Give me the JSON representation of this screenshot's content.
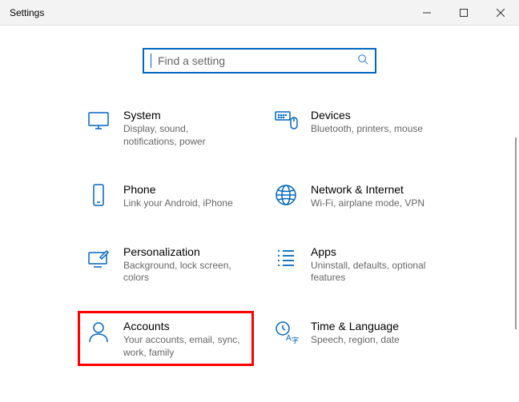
{
  "window": {
    "title": "Settings"
  },
  "search": {
    "placeholder": "Find a setting"
  },
  "tiles": {
    "system": {
      "title": "System",
      "desc": "Display, sound, notifications, power"
    },
    "devices": {
      "title": "Devices",
      "desc": "Bluetooth, printers, mouse"
    },
    "phone": {
      "title": "Phone",
      "desc": "Link your Android, iPhone"
    },
    "network": {
      "title": "Network & Internet",
      "desc": "Wi-Fi, airplane mode, VPN"
    },
    "personal": {
      "title": "Personalization",
      "desc": "Background, lock screen, colors"
    },
    "apps": {
      "title": "Apps",
      "desc": "Uninstall, defaults, optional features"
    },
    "accounts": {
      "title": "Accounts",
      "desc": "Your accounts, email, sync, work, family"
    },
    "time": {
      "title": "Time & Language",
      "desc": "Speech, region, date"
    }
  },
  "colors": {
    "accent": "#0067c0",
    "highlight": "#ff0000"
  }
}
